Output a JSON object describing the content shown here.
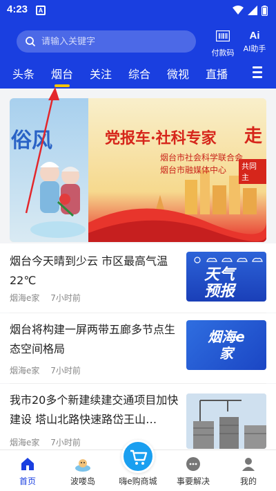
{
  "status_bar": {
    "time": "4:23",
    "notif_icon": "A"
  },
  "search": {
    "placeholder": "请输入关键字"
  },
  "header_actions": [
    {
      "label": "付款码",
      "icon": "barcode-icon"
    },
    {
      "label": "AI助手",
      "icon": "ai-icon"
    }
  ],
  "ai_icon_text": "Ai",
  "tabs": [
    "头条",
    "烟台",
    "关注",
    "综合",
    "微视",
    "直播"
  ],
  "active_tab": "烟台",
  "banner": {
    "left_text": "俗风",
    "title": "党报车·社科专家",
    "title_tail": "走",
    "sub_line1": "烟台市社会科学联合会",
    "sub_line2": "烟台市融媒体中心",
    "tag": "共同主"
  },
  "articles": [
    {
      "title": "烟台今天晴到少云 市区最高气温22℃",
      "source": "烟海e家",
      "time": "7小时前",
      "thumb_text": "天气预报"
    },
    {
      "title": "烟台将构建一屏两带五廊多节点生态空间格局",
      "source": "烟海e家",
      "time": "7小时前",
      "thumb_text": "烟海e家"
    },
    {
      "title": "我市20多个新建续建交通项目加快建设 塔山北路快速路岱王山…",
      "source": "烟海e家",
      "time": "7小时前",
      "thumb_text": ""
    }
  ],
  "bottom_nav": [
    {
      "label": "首页",
      "icon": "home-icon"
    },
    {
      "label": "波喽岛",
      "icon": "island-icon"
    },
    {
      "label": "嗨e购商城",
      "icon": "shopping-cart-icon"
    },
    {
      "label": "事要解决",
      "icon": "chat-icon"
    },
    {
      "label": "我的",
      "icon": "user-icon"
    }
  ],
  "colors": {
    "brand_blue": "#1a3fe0",
    "tab_indicator": "#f4c400",
    "arrow_red": "#e3262b"
  }
}
